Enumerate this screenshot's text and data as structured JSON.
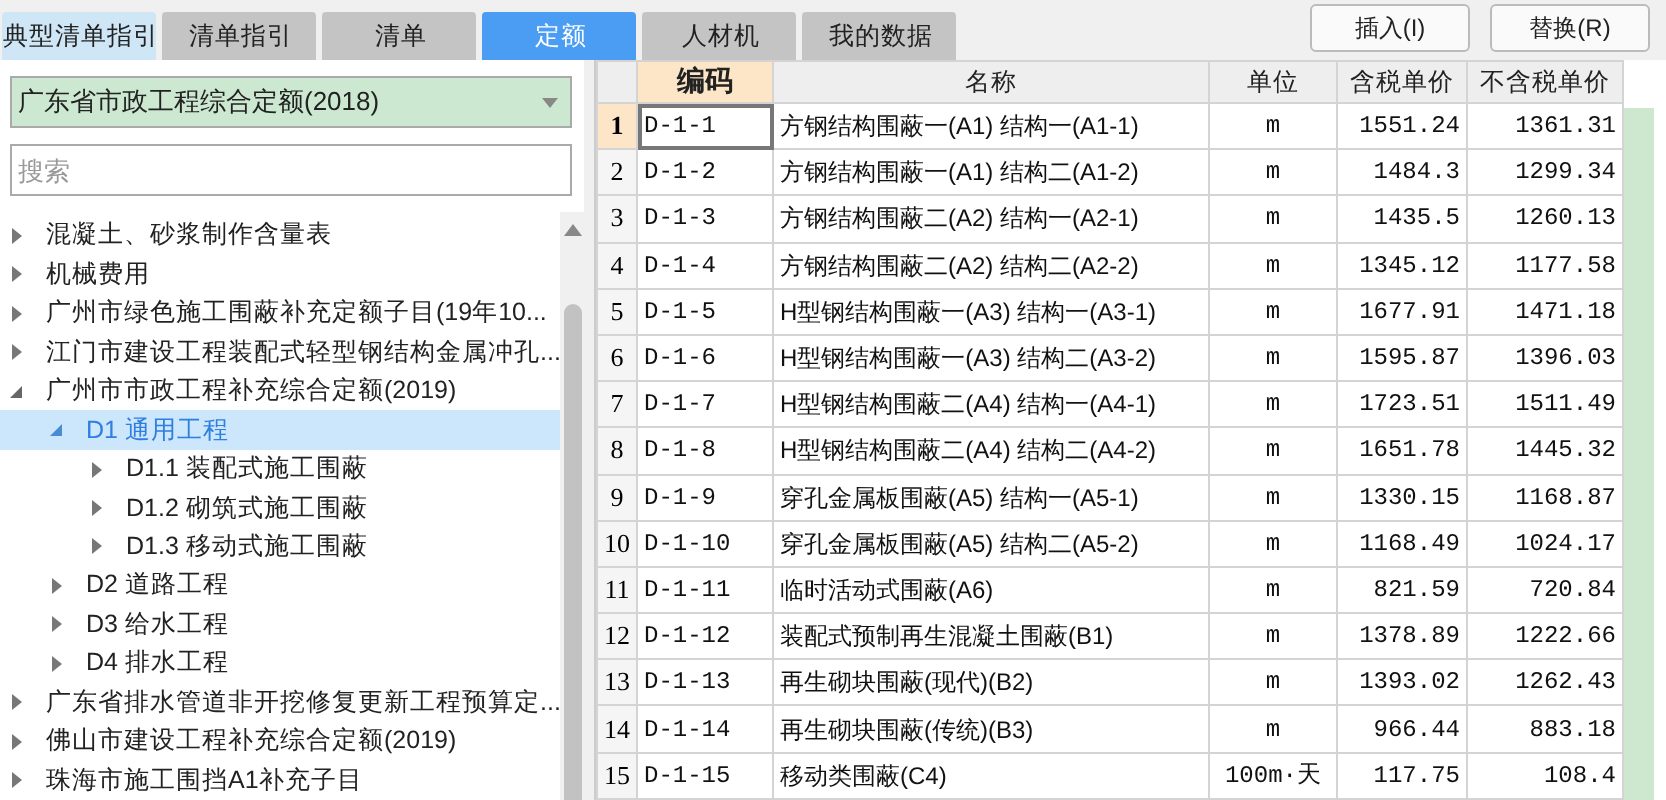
{
  "tabs": [
    {
      "label": "典型清单指引",
      "selected": false,
      "kind": "light"
    },
    {
      "label": "清单指引",
      "selected": false,
      "kind": "plain"
    },
    {
      "label": "清单",
      "selected": false,
      "kind": "plain"
    },
    {
      "label": "定额",
      "selected": true,
      "kind": "plain"
    },
    {
      "label": "人材机",
      "selected": false,
      "kind": "plain"
    },
    {
      "label": "我的数据",
      "selected": false,
      "kind": "plain"
    }
  ],
  "buttons": [
    "插入(I)",
    "替换(R)"
  ],
  "library_select": {
    "value": "广东省市政工程综合定额(2018)"
  },
  "search": {
    "placeholder": "搜索"
  },
  "tree": [
    {
      "label": "混凝土、砂浆制作含量表",
      "expanded": false,
      "selected": false
    },
    {
      "label": "机械费用",
      "expanded": false,
      "selected": false
    },
    {
      "label": "广州市绿色施工围蔽补充定额子目(19年10...",
      "expanded": false,
      "selected": false
    },
    {
      "label": "江门市建设工程装配式轻型钢结构金属冲孔...",
      "expanded": false,
      "selected": false
    },
    {
      "label": "广州市市政工程补充综合定额(2019)",
      "expanded": true,
      "selected": false,
      "children": [
        {
          "label": "D1 通用工程",
          "expanded": true,
          "selected": true,
          "children": [
            {
              "label": "D1.1 装配式施工围蔽",
              "expanded": false,
              "selected": false
            },
            {
              "label": "D1.2 砌筑式施工围蔽",
              "expanded": false,
              "selected": false
            },
            {
              "label": "D1.3 移动式施工围蔽",
              "expanded": false,
              "selected": false
            }
          ]
        },
        {
          "label": "D2 道路工程",
          "expanded": false,
          "selected": false
        },
        {
          "label": "D3 给水工程",
          "expanded": false,
          "selected": false
        },
        {
          "label": "D4 排水工程",
          "expanded": false,
          "selected": false
        }
      ]
    },
    {
      "label": "广东省排水管道非开挖修复更新工程预算定...",
      "expanded": false,
      "selected": false
    },
    {
      "label": "佛山市建设工程补充综合定额(2019)",
      "expanded": false,
      "selected": false
    },
    {
      "label": "珠海市施工围挡A1补充子目",
      "expanded": false,
      "selected": false
    }
  ],
  "table": {
    "columns": [
      {
        "label": "编码",
        "selected": true
      },
      {
        "label": "名称",
        "selected": false
      },
      {
        "label": "单位",
        "selected": false
      },
      {
        "label": "含税单价",
        "selected": false
      },
      {
        "label": "不含税单价",
        "selected": false
      }
    ],
    "rows": [
      {
        "index": "1",
        "selected": true,
        "cells": [
          "D-1-1",
          "方钢结构围蔽一(A1) 结构一(A1-1)",
          "m",
          "1551.24",
          "1361.31"
        ]
      },
      {
        "index": "2",
        "selected": false,
        "cells": [
          "D-1-2",
          "方钢结构围蔽一(A1) 结构二(A1-2)",
          "m",
          "1484.3",
          "1299.34"
        ]
      },
      {
        "index": "3",
        "selected": false,
        "cells": [
          "D-1-3",
          "方钢结构围蔽二(A2) 结构一(A2-1)",
          "m",
          "1435.5",
          "1260.13"
        ]
      },
      {
        "index": "4",
        "selected": false,
        "cells": [
          "D-1-4",
          "方钢结构围蔽二(A2) 结构二(A2-2)",
          "m",
          "1345.12",
          "1177.58"
        ]
      },
      {
        "index": "5",
        "selected": false,
        "cells": [
          "D-1-5",
          "H型钢结构围蔽一(A3) 结构一(A3-1)",
          "m",
          "1677.91",
          "1471.18"
        ]
      },
      {
        "index": "6",
        "selected": false,
        "cells": [
          "D-1-6",
          "H型钢结构围蔽一(A3) 结构二(A3-2)",
          "m",
          "1595.87",
          "1396.03"
        ]
      },
      {
        "index": "7",
        "selected": false,
        "cells": [
          "D-1-7",
          "H型钢结构围蔽二(A4) 结构一(A4-1)",
          "m",
          "1723.51",
          "1511.49"
        ]
      },
      {
        "index": "8",
        "selected": false,
        "cells": [
          "D-1-8",
          "H型钢结构围蔽二(A4) 结构二(A4-2)",
          "m",
          "1651.78",
          "1445.32"
        ]
      },
      {
        "index": "9",
        "selected": false,
        "cells": [
          "D-1-9",
          "穿孔金属板围蔽(A5) 结构一(A5-1)",
          "m",
          "1330.15",
          "1168.87"
        ]
      },
      {
        "index": "10",
        "selected": false,
        "cells": [
          "D-1-10",
          "穿孔金属板围蔽(A5) 结构二(A5-2)",
          "m",
          "1168.49",
          "1024.17"
        ]
      },
      {
        "index": "11",
        "selected": false,
        "cells": [
          "D-1-11",
          "临时活动式围蔽(A6)",
          "m",
          "821.59",
          "720.84"
        ]
      },
      {
        "index": "12",
        "selected": false,
        "cells": [
          "D-1-12",
          "装配式预制再生混凝土围蔽(B1)",
          "m",
          "1378.89",
          "1222.66"
        ]
      },
      {
        "index": "13",
        "selected": false,
        "cells": [
          "D-1-13",
          "再生砌块围蔽(现代)(B2)",
          "m",
          "1393.02",
          "1262.43"
        ]
      },
      {
        "index": "14",
        "selected": false,
        "cells": [
          "D-1-14",
          "再生砌块围蔽(传统)(B3)",
          "m",
          "966.44",
          "883.18"
        ]
      },
      {
        "index": "15",
        "selected": false,
        "cells": [
          "D-1-15",
          "移动类围蔽(C4)",
          "100m·天",
          "117.75",
          "108.4"
        ]
      }
    ]
  }
}
